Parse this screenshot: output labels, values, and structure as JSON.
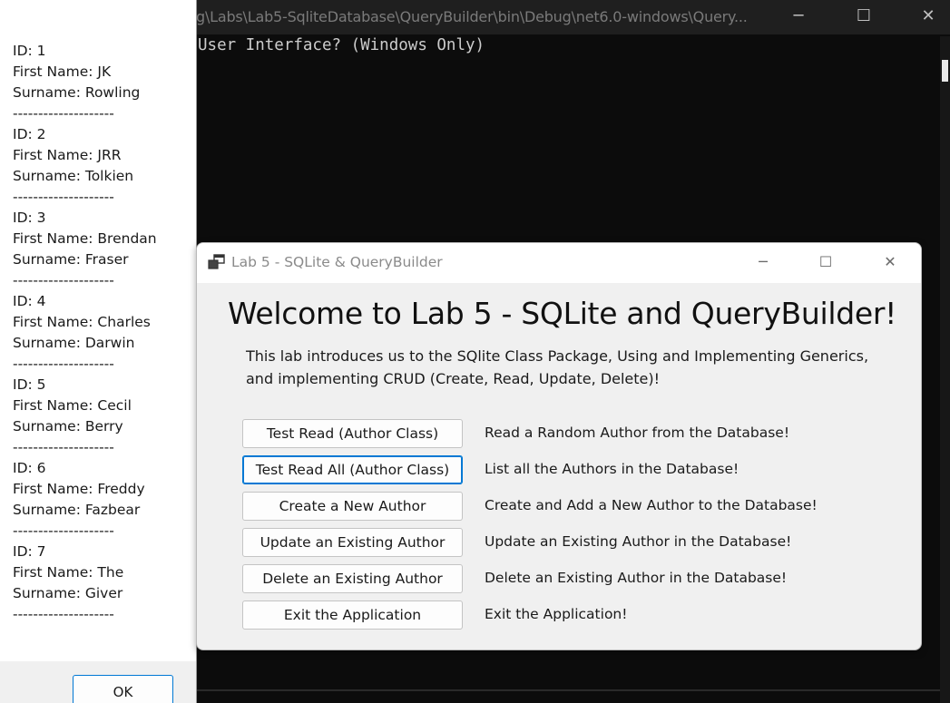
{
  "console": {
    "title": "g\\Labs\\Lab5-SqliteDatabase\\QueryBuilder\\bin\\Debug\\net6.0-windows\\Query...",
    "output_line": "User Interface? (Windows Only)",
    "minimize": "─",
    "maximize": "☐",
    "close": "✕"
  },
  "message_box": {
    "text": "ID: 1\nFirst Name: JK\nSurname: Rowling\n--------------------\nID: 2\nFirst Name: JRR\nSurname: Tolkien\n--------------------\nID: 3\nFirst Name: Brendan\nSurname: Fraser\n--------------------\nID: 4\nFirst Name: Charles\nSurname: Darwin\n--------------------\nID: 5\nFirst Name: Cecil\nSurname: Berry\n--------------------\nID: 6\nFirst Name: Freddy\nSurname: Fazbear\n--------------------\nID: 7\nFirst Name: The\nSurname: Giver\n--------------------",
    "ok_label": "OK"
  },
  "form": {
    "title": "Lab 5 - SQLite & QueryBuilder",
    "minimize": "─",
    "maximize": "☐",
    "close": "✕",
    "heading": "Welcome to Lab 5 - SQLite and QueryBuilder!",
    "intro": "This lab introduces us to the SQlite Class  Package, Using and Implementing Generics, and implementing CRUD (Create, Read, Update, Delete)!",
    "actions": [
      {
        "button": "Test Read (Author Class)",
        "description": "Read a Random Author from the Database!"
      },
      {
        "button": "Test Read All (Author Class)",
        "description": "List all the Authors in the Database!"
      },
      {
        "button": "Create a New Author",
        "description": "Create and Add a New Author to the Database!"
      },
      {
        "button": "Update an Existing Author",
        "description": "Update an Existing Author in the Database!"
      },
      {
        "button": "Delete an Existing Author",
        "description": "Delete an Existing Author in the Database!"
      },
      {
        "button": "Exit the Application",
        "description": "Exit the Application!"
      }
    ]
  },
  "colors": {
    "console_bg": "#0c0c0c",
    "form_bg": "#f0f0f0",
    "focus_accent": "#0078d4"
  }
}
